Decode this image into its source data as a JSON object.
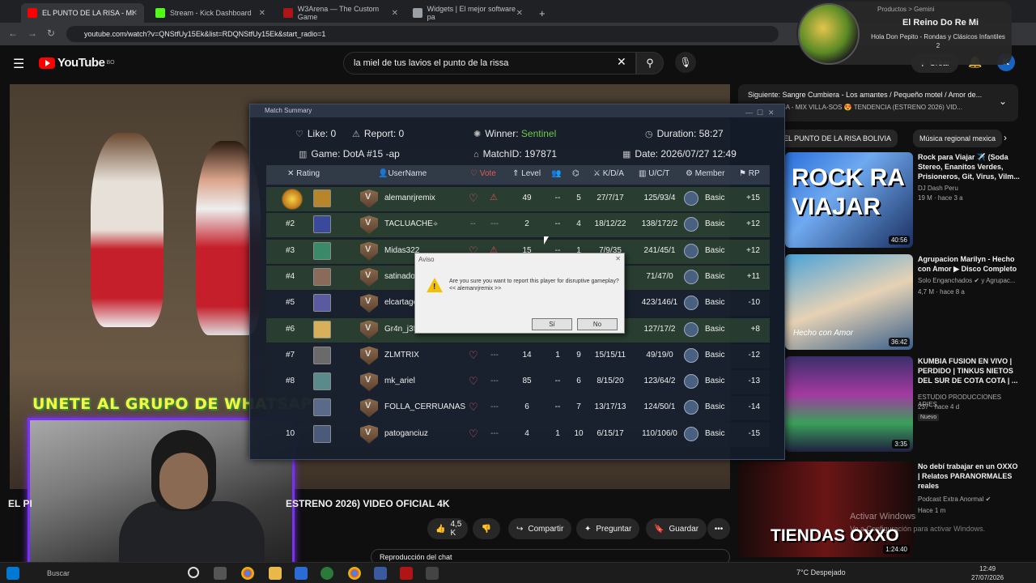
{
  "browser": {
    "tabs": [
      {
        "label": "EL PUNTO DE LA RISA - MI",
        "color": "#ff0000",
        "active": true
      },
      {
        "label": "Stream - Kick Dashboard",
        "color": "#53fc18",
        "active": false
      },
      {
        "label": "W3Arena — The Custom Game",
        "color": "#b01515",
        "active": false
      },
      {
        "label": "Widgets | El mejor software pa",
        "color": "#9aa0a6",
        "active": false
      }
    ],
    "new_tab": "+",
    "url": "youtube.com/watch?v=QNStfUy15Ek&list=RDQNStfUy15Ek&start_radio=1"
  },
  "youtube": {
    "logo": "YouTube",
    "logo_region": "BO",
    "search_value": "la miel de tus lavios el punto de la rissa",
    "create_label": "Crear",
    "avatar_letter": "K"
  },
  "now_playing": {
    "title": "El Reino Do Re Mi",
    "subtitle": "Hola Don Pepito - Rondas y Clásicos Infantiles 2",
    "top_text": "Productos > Gemini"
  },
  "overlay_text": "UNETE AL GRUPO DE WHATSAPP",
  "video": {
    "title_left": "EL PI",
    "title": "ESTRENO 2026) VIDEO OFICIAL 4K",
    "likes": "4,5 K",
    "share": "Compartir",
    "ask": "Preguntar",
    "save": "Guardar",
    "chat_replay": "Reproducción del chat"
  },
  "sidebar": {
    "next_label": "Siguiente: Sangre Cumbiera - Los amantes / Pequeño motel / Amor de...",
    "next_sub": "O DE LA RISA - MIX VILLA-SOS 😍 TENDENCIA (ESTRENO 2026) VID...",
    "chips": [
      "EL PUNTO DE LA RISA BOLIVIA",
      "Música regional mexica"
    ],
    "recs": [
      {
        "title": "Rock para Viajar ✈️ (Soda Stereo, Enanitos Verdes, Prisioneros, Git, Virus, Vilm...",
        "channel": "DJ Dash Peru",
        "meta": "19 M · hace 3 a",
        "duration": "40:56",
        "thumb_text": "ROCK RA VIAJAR",
        "new": ""
      },
      {
        "title": "Agrupacion Marilyn - Hecho con Amor ▶ Disco Completo",
        "channel": "Solo Enganchados ✔ y Agrupac...",
        "meta": "4,7 M · hace 8 a",
        "duration": "36:42",
        "thumb_text": "Hecho con Amor",
        "new": ""
      },
      {
        "title": "KUMBIA FUSION EN VIVO | PERDIDO | TINKUS NIETOS DEL SUR DE COTA COTA | ...",
        "channel": "ESTUDIO PRODUCCIONES ARIES",
        "meta": "237 · hace 4 d",
        "duration": "3:35",
        "thumb_text": "",
        "new": "Nuevo"
      },
      {
        "title": "No debí trabajar en un OXXO | Relatos PARANORMALES reales",
        "channel": "Podcast Extra Anormal ✔",
        "meta": "Hace 1 m",
        "duration": "1:24:40",
        "thumb_text": "TIENDAS OXXO",
        "new": ""
      }
    ]
  },
  "match": {
    "window_title": "Match Summary",
    "like": "Like: 0",
    "report": "Report: 0",
    "winner_label": "Winner:",
    "winner": "Sentinel",
    "duration": "Duration: 58:27",
    "game": "Game: DotA #15 -ap",
    "match_id": "MatchID: 197871",
    "date": "Date: 2026/07/27 12:49",
    "headers": [
      "Rating",
      "UserName",
      "Vote",
      "Level",
      "K/D/A",
      "U/C/T",
      "Member",
      "RP"
    ],
    "rows": [
      {
        "rank": "",
        "name": "alemanrjremix",
        "level": "49",
        "c1": "--",
        "c2": "5",
        "kda": "27/7/17",
        "uct": "125/93/4",
        "member": "Basic",
        "rp": "+15",
        "green": true
      },
      {
        "rank": "#2",
        "name": "TACLUACHE",
        "level": "2",
        "c1": "--",
        "c2": "4",
        "kda": "18/12/22",
        "uct": "138/172/2",
        "member": "Basic",
        "rp": "+12",
        "green": true
      },
      {
        "rank": "#3",
        "name": "Midas322",
        "level": "15",
        "c1": "--",
        "c2": "1",
        "kda": "7/9/35",
        "uct": "241/45/1",
        "member": "Basic",
        "rp": "+12",
        "green": true
      },
      {
        "rank": "#4",
        "name": "satinador",
        "level": "",
        "c1": "",
        "c2": "",
        "kda": "",
        "uct": "71/47/0",
        "member": "Basic",
        "rp": "+11",
        "green": true
      },
      {
        "rank": "#5",
        "name": "elcartage",
        "level": "",
        "c1": "",
        "c2": "",
        "kda": "",
        "uct": "423/146/1",
        "member": "Basic",
        "rp": "-10",
        "green": false
      },
      {
        "rank": "#6",
        "name": "Gr4n_j3fe",
        "level": "",
        "c1": "",
        "c2": "",
        "kda": "",
        "uct": "127/17/2",
        "member": "Basic",
        "rp": "+8",
        "green": true
      },
      {
        "rank": "#7",
        "name": "ZLMTRIX",
        "level": "14",
        "c1": "1",
        "c2": "9",
        "kda": "15/15/11",
        "uct": "49/19/0",
        "member": "Basic",
        "rp": "-12",
        "green": false
      },
      {
        "rank": "#8",
        "name": "mk_ariel",
        "level": "85",
        "c1": "--",
        "c2": "6",
        "kda": "8/15/20",
        "uct": "123/64/2",
        "member": "Basic",
        "rp": "-13",
        "green": false
      },
      {
        "rank": "",
        "name": "FOLLA_CERRUANAS",
        "level": "6",
        "c1": "--",
        "c2": "7",
        "kda": "13/17/13",
        "uct": "124/50/1",
        "member": "Basic",
        "rp": "-14",
        "green": false
      },
      {
        "rank": "10",
        "name": "patoganciuz",
        "level": "4",
        "c1": "1",
        "c2": "10",
        "kda": "6/15/17",
        "uct": "110/106/0",
        "member": "Basic",
        "rp": "-15",
        "green": false
      }
    ]
  },
  "confirm": {
    "title": "Aviso",
    "message": "Are you sure you want to report this player for disruptive gameplay?",
    "player": "<< alemanrjremix >>",
    "yes": "Sí",
    "no": "No"
  },
  "taskbar": {
    "weather": "7°C  Despejado",
    "time": "12:49",
    "date": "27/07/2026",
    "search": "Buscar"
  },
  "watermark": "Activar Windows",
  "watermark_sub": "Ve a Configuración para activar Windows."
}
